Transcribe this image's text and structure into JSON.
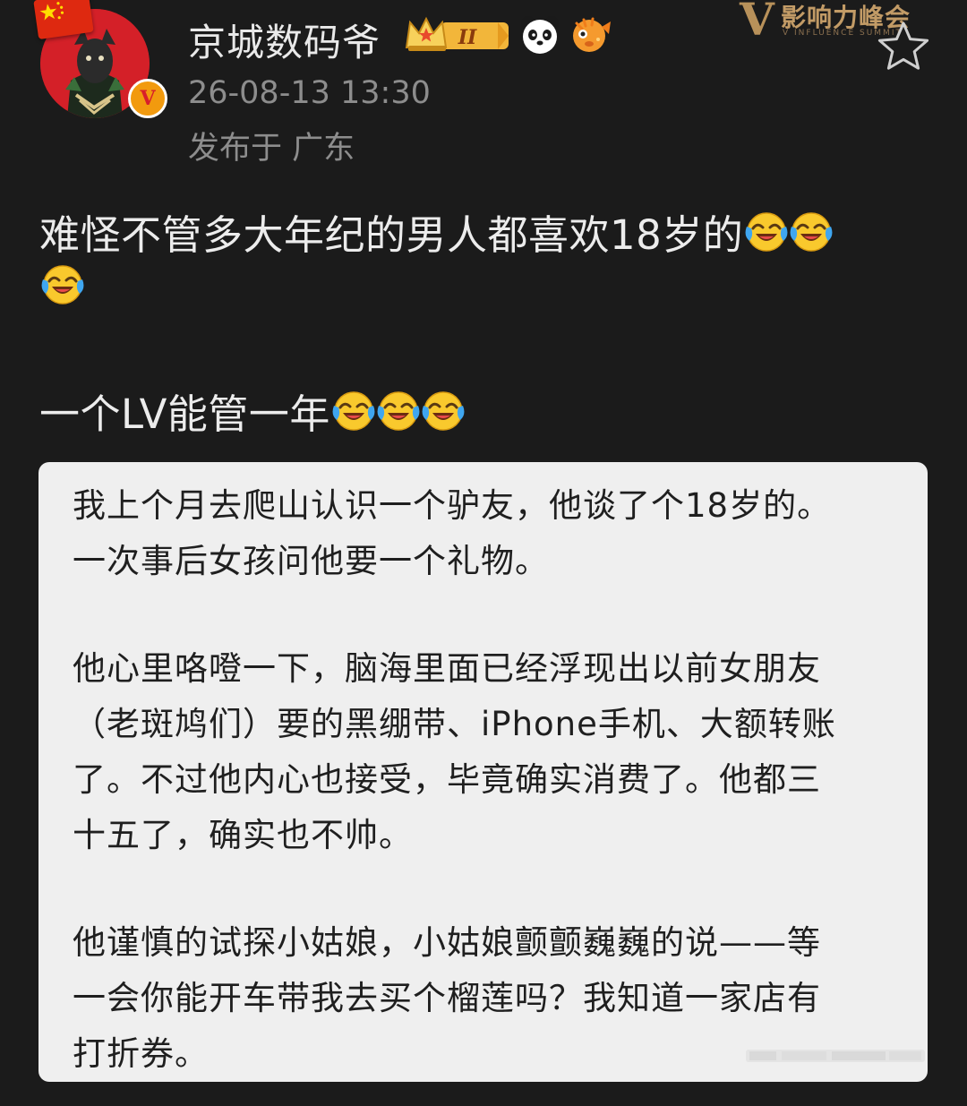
{
  "post": {
    "username": "京城数码爷",
    "timestamp": "26-08-13 13:30",
    "location": "发布于 广东",
    "verified_mark": "V",
    "level_badge": "II",
    "summit_logo": {
      "text_cn": "影响力峰会",
      "text_en": "V INFLUENCE SUMMIT",
      "mark": "V"
    },
    "line1": "难怪不管多大年纪的男人都喜欢18岁的",
    "line3": "一个LV能管一年"
  },
  "card": {
    "lines": [
      "我上个月去爬山认识一个驴友，他谈了个18岁的。",
      "一次事后女孩问他要一个礼物。",
      "他心里咯噔一下，脑海里面已经浮现出以前女朋友",
      "（老斑鸠们）要的黑绷带、iPhone手机、大额转账",
      "了。不过他内心也接受，毕竟确实消费了。他都三",
      "十五了，确实也不帅。",
      "他谨慎的试探小姑娘，小姑娘颤颤巍巍的说——等",
      "一会你能开车带我去买个榴莲吗？我知道一家店有",
      "打折券。"
    ]
  },
  "icons": {
    "emoji": "laughing-crying-face-icon",
    "star": "star-outline-icon",
    "panda": "panda-icon",
    "fish": "pufferfish-icon",
    "crown": "crown-icon",
    "flag": "china-flag-icon"
  },
  "colors": {
    "background": "#1b1b1b",
    "card": "#efefef",
    "verified": "#f29a0e",
    "gold": "#c29b66",
    "meta_text": "#8d8d8d"
  }
}
